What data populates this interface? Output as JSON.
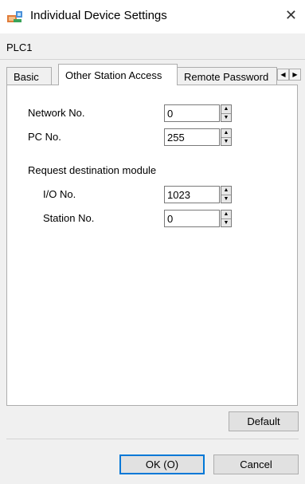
{
  "window": {
    "title": "Individual Device Settings",
    "close_glyph": "✕"
  },
  "device": {
    "name": "PLC1"
  },
  "tabs": [
    {
      "label": "Basic",
      "active": false
    },
    {
      "label": "Other Station Access",
      "active": true
    },
    {
      "label": "Remote Password",
      "active": false
    }
  ],
  "tab_scroll": {
    "left": "◀",
    "right": "▶"
  },
  "fields": {
    "network_no": {
      "label": "Network No.",
      "value": "0"
    },
    "pc_no": {
      "label": "PC No.",
      "value": "255"
    },
    "request_group": {
      "label": "Request destination module"
    },
    "io_no": {
      "label": "I/O No.",
      "value": "1023"
    },
    "station_no": {
      "label": "Station No.",
      "value": "0"
    }
  },
  "spin": {
    "up": "▲",
    "down": "▼"
  },
  "buttons": {
    "default": "Default",
    "ok": "OK (O)",
    "cancel": "Cancel"
  },
  "colors": {
    "accent": "#0078d7",
    "panel": "#ffffff",
    "background": "#f0f0f0"
  },
  "icons": {
    "app": "device-settings-icon"
  }
}
